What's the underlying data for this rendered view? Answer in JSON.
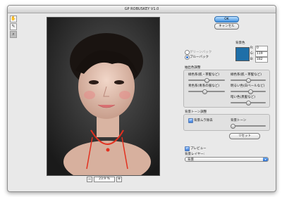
{
  "window": {
    "title": "GP ROBUSKEY V1.0"
  },
  "tools": [
    {
      "name": "hand-tool-icon",
      "glyph": "✋"
    },
    {
      "name": "eyedropper-tool-icon",
      "glyph": "✎"
    },
    {
      "name": "zoom-tool-icon",
      "glyph": "⌕"
    }
  ],
  "preview": {
    "zoom_minus": "−",
    "zoom_level": "23.9 %",
    "zoom_plus": "+"
  },
  "buttons": {
    "ok": "OK",
    "cancel": "キャンセル",
    "reset": "リセット"
  },
  "backing": {
    "green_label": "グリーンバック",
    "blue_label": "ブルーバック",
    "selected": "blue"
  },
  "bg_color": {
    "label": "背景色",
    "swatch_color": "#1f6fa8",
    "r_label": "R:",
    "r": "0",
    "g_label": "G:",
    "g": "119",
    "b_label": "B:",
    "b": "182"
  },
  "removal": {
    "title": "抽出色調整",
    "sliders": [
      {
        "label": "緑色系(肌・茶髪など)",
        "value": 0.5
      },
      {
        "label": "緑色系(肌・茶髪など)",
        "value": 0.5
      },
      {
        "label": "青色系(青系の服など)",
        "value": 0.45
      },
      {
        "label": "明るい色(白ベールなど)",
        "value": 0.55
      },
      {
        "label": "暗い色(黒髪など)",
        "value": 0.5
      }
    ]
  },
  "tone": {
    "title": "背景トーン調整",
    "checkbox_label": "背景ムラ除去",
    "checked": true,
    "slider_label": "背景トーン",
    "slider_value": 0.05
  },
  "preview_toggle": {
    "label": "プレビュー",
    "checked": true
  },
  "layer": {
    "label": "背景レイヤー:",
    "selected": "背景"
  }
}
